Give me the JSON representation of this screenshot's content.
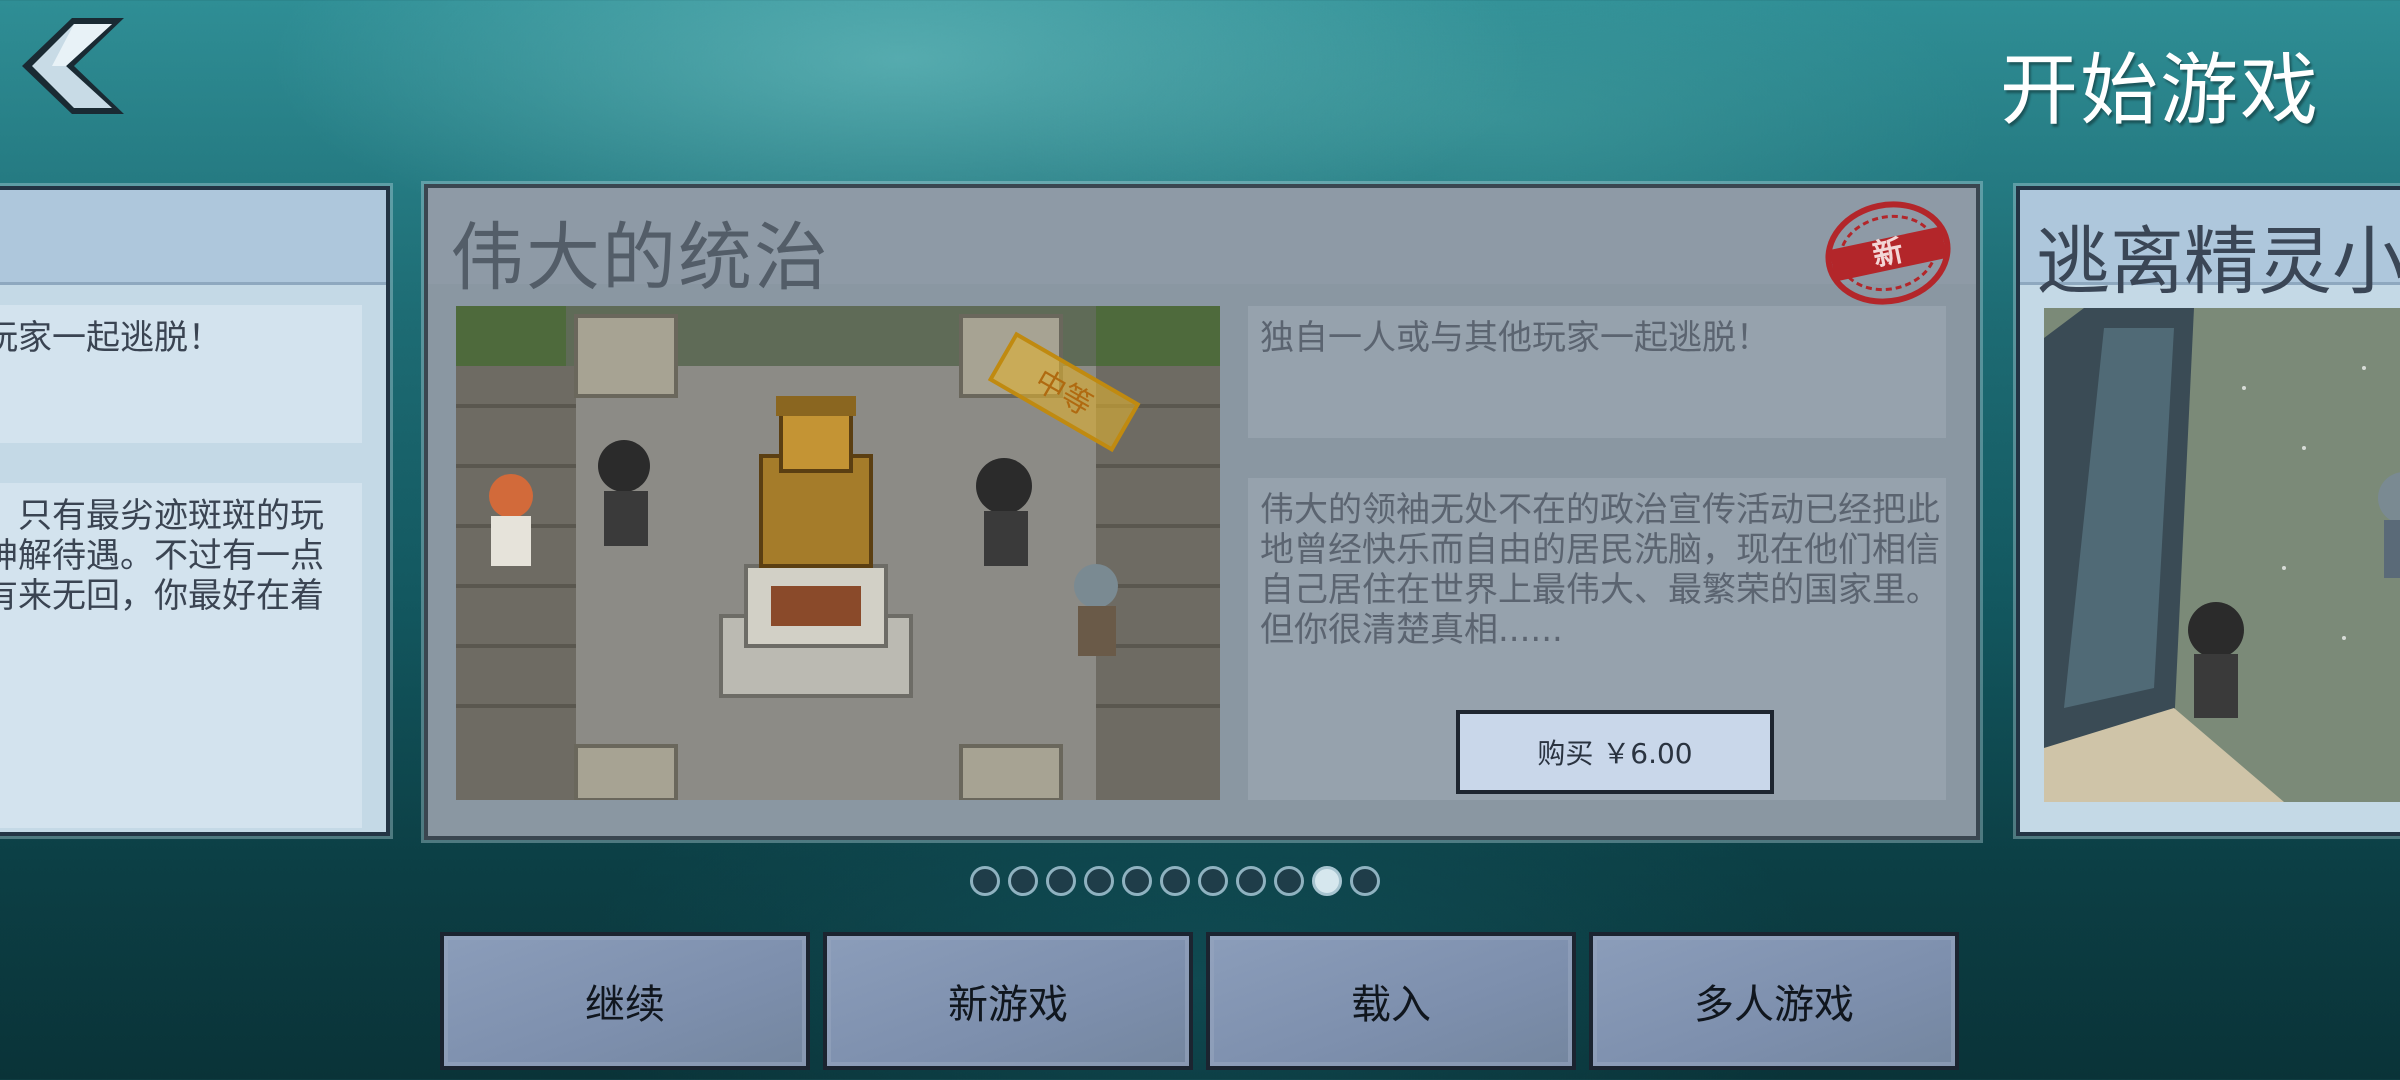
{
  "header": {
    "title": "开始游戏",
    "back_icon": "back-arrow-icon"
  },
  "left_card": {
    "tagline": "玩家一起逃脱！",
    "description_lines": [
      "，只有最劣迹斑斑的玩",
      "神解待遇。不过有一点",
      "有来无回，你最好在着"
    ]
  },
  "main_card": {
    "name": "伟大的统治",
    "stamp_new": "新",
    "difficulty_badge": "中等",
    "tagline": "独自一人或与其他玩家一起逃脱！",
    "description": "伟大的领袖无处不在的政治宣传活动已经把此地曾经快乐而自由的居民洗脑，现在他们相信自己居住在世界上最伟大、最繁荣的国家里。但你很清楚真相......",
    "buy_button": "购买 ￥6.00"
  },
  "right_card": {
    "name": "逃离精灵小"
  },
  "pagination": {
    "count": 11,
    "active_index": 9
  },
  "menu": {
    "continue": "继续",
    "new_game": "新游戏",
    "load": "载入",
    "multiplayer": "多人游戏"
  },
  "colors": {
    "accent_red": "#b3262a",
    "badge_gold": "#e0b030"
  }
}
